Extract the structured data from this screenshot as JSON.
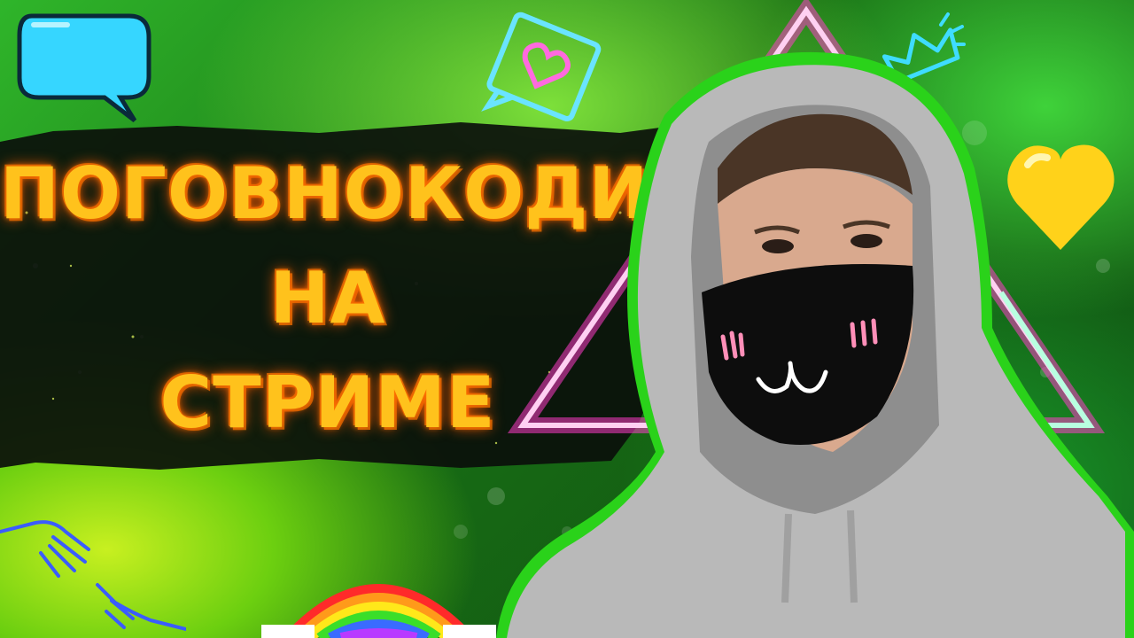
{
  "thumbnail": {
    "title_lines": [
      "ПОГОВНОКОДИМ",
      "НА",
      "СТРИМЕ"
    ]
  },
  "colors": {
    "title_fill": "#ffc21c",
    "title_glow": "#ff6a00",
    "background": "#2fb52a",
    "triangle_neon": "#ff3cc8",
    "speech_bubble": "#36d6ff",
    "heart_sticker": "#ff6adf",
    "heart_yellow": "#ffd21a"
  },
  "icons": [
    "speech-bubble-icon",
    "heart-message-icon",
    "crown-icon",
    "yellow-heart-icon",
    "neon-triangle",
    "neon-hands-icon",
    "rainbow-icon",
    "person-in-hoodie"
  ]
}
